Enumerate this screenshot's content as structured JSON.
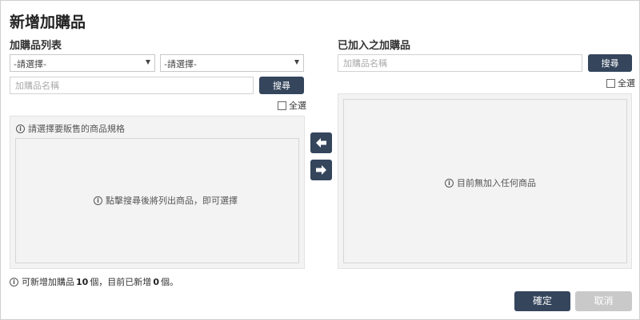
{
  "dialog": {
    "title": "新增加購品",
    "confirm_label": "確定",
    "cancel_label": "取消"
  },
  "left": {
    "heading": "加購品列表",
    "select1_value": "-請選擇-",
    "select2_value": "-請選擇-",
    "search_placeholder": "加購品名稱",
    "search_button": "搜尋",
    "select_all_label": "全選",
    "panel_hint": "請選擇要販售的商品規格",
    "empty_message": "點擊搜尋後將列出商品，即可選擇"
  },
  "right": {
    "heading": "已加入之加購品",
    "search_placeholder": "加購品名稱",
    "search_button": "搜尋",
    "select_all_label": "全選",
    "empty_message": "目前無加入任何商品"
  },
  "transfer": {
    "left_icon": "arrow-left-icon",
    "right_icon": "arrow-right-icon"
  },
  "footer": {
    "prefix": "可新增加購品",
    "max_count": "10",
    "middle": "個，目前已新增",
    "added_count": "0",
    "suffix": "個。"
  },
  "colors": {
    "primary": "#34455c",
    "disabled": "#c9c9c9",
    "panel_bg": "#f3f3f3"
  }
}
